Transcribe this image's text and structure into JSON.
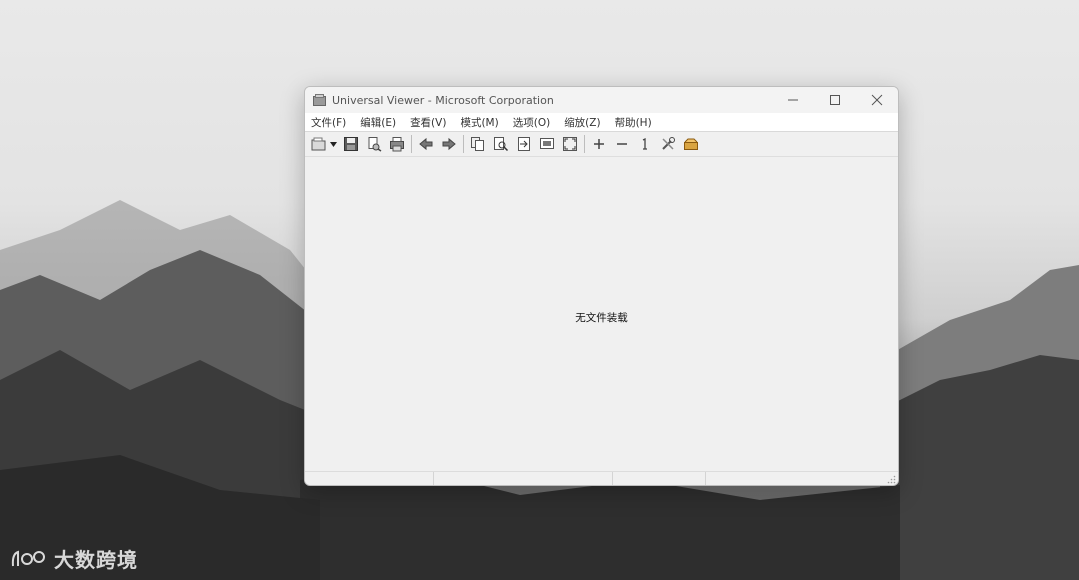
{
  "window": {
    "title": "Universal Viewer - Microsoft Corporation",
    "controls": {
      "minimize": "—",
      "maximize": "☐",
      "close": "✕"
    }
  },
  "menu": {
    "items": [
      {
        "label": "文件(F)"
      },
      {
        "label": "编辑(E)"
      },
      {
        "label": "查看(V)"
      },
      {
        "label": "模式(M)"
      },
      {
        "label": "选项(O)"
      },
      {
        "label": "缩放(Z)"
      },
      {
        "label": "帮助(H)"
      }
    ]
  },
  "toolbar": {
    "icons": [
      "open-folder-icon",
      "save-icon",
      "print-preview-icon",
      "print-icon",
      "back-icon",
      "forward-icon",
      "copy-icon",
      "find-icon",
      "goto-icon",
      "fit-window-icon",
      "fullscreen-icon",
      "zoom-in-icon",
      "zoom-out-icon",
      "original-size-icon",
      "options-icon",
      "plugins-icon"
    ]
  },
  "content": {
    "empty_message": "无文件装载"
  },
  "statusbar": {
    "cells": [
      "",
      "",
      "",
      ""
    ]
  },
  "watermark": {
    "text": "大数跨境"
  },
  "colors": {
    "window_bg": "#f0f0f0",
    "menu_bg": "#ffffff",
    "title_text": "#555555"
  }
}
